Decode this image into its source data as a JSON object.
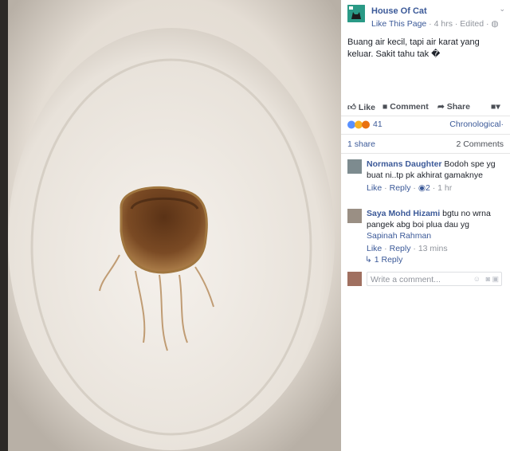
{
  "post": {
    "page_name": "House Of Cat",
    "like_page": "Like This Page",
    "meta_time": " · 4 hrs · Edited · ",
    "text": "Buang air kecil, tapi air karat yang keluar. Sakit tahu tak �"
  },
  "actions": {
    "like": "Like",
    "comment": "Comment",
    "share": "Share"
  },
  "reactions": {
    "count": "41",
    "sort": "Chronological"
  },
  "stats": {
    "shares": "1 share",
    "comments": "2 Comments"
  },
  "comments": [
    {
      "name": "Normans Daughter",
      "text": " Bodoh spe yg buat ni..tp pk akhirat gamaknye",
      "like": "Like",
      "reply": "Reply",
      "reacts": "2",
      "time": "1 hr"
    },
    {
      "name": "Saya Mohd Hizami",
      "text": " bgtu no wrna pangek abg boi plua dau yg",
      "mention": "Sapinah Rahman",
      "like": "Like",
      "reply": "Reply",
      "time": "13 mins"
    }
  ],
  "replies_link": "1 Reply",
  "composer": {
    "placeholder": "Write a comment..."
  },
  "colors": {
    "link": "#3b5998",
    "muted": "#90949c"
  }
}
